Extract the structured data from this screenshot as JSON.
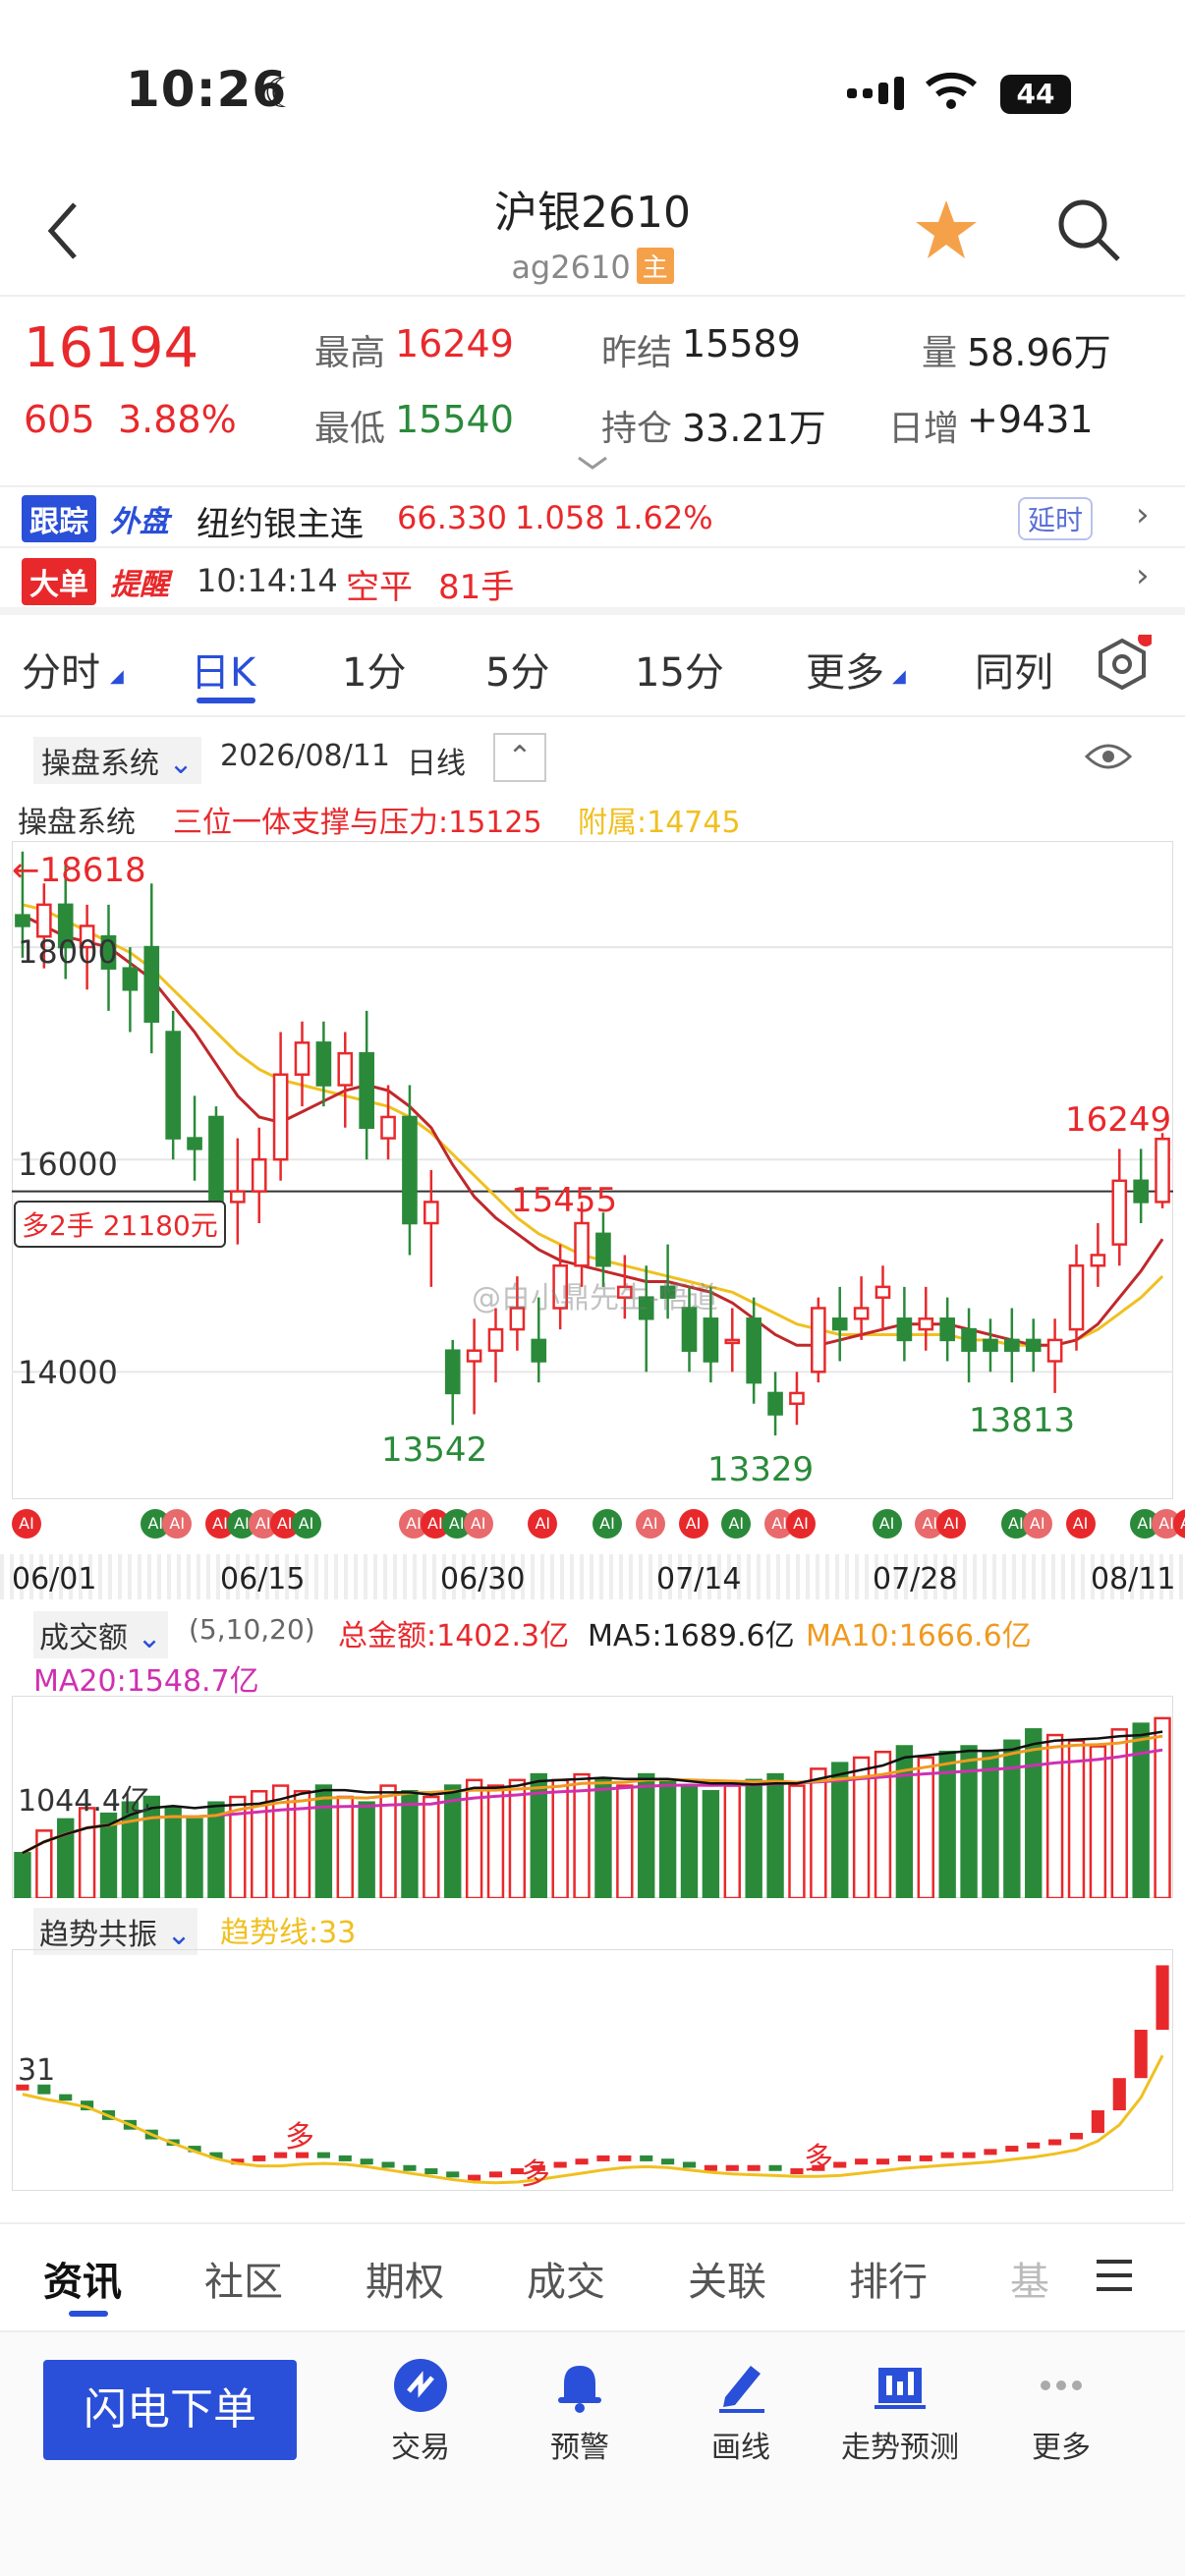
{
  "status_bar": {
    "time": "10:26",
    "battery": "44"
  },
  "header": {
    "title": "沪银2610",
    "code": "ag2610",
    "main_tag": "主"
  },
  "quote": {
    "last_price": "16194",
    "change": "605",
    "change_pct": "3.88%",
    "high_label": "最高",
    "high": "16249",
    "low_label": "最低",
    "low": "15540",
    "settle_label": "昨结",
    "settle": "15589",
    "oi_label": "持仓",
    "oi": "33.21万",
    "vol_label": "量",
    "vol": "58.96万",
    "daily_inc_label": "日增",
    "daily_inc": "+9431"
  },
  "track": {
    "badge1": "跟踪",
    "badge2": "外盘",
    "name": "纽约银主连",
    "price": "66.330",
    "chg": "1.058",
    "pct": "1.62%",
    "delay": "延时"
  },
  "alert": {
    "badge1": "大单",
    "badge2": "提醒",
    "time": "10:14:14",
    "type": "空平",
    "qty": "81手"
  },
  "period_tabs": [
    "分时",
    "日K",
    "1分",
    "5分",
    "15分",
    "更多",
    "同列"
  ],
  "chart_toolbar": {
    "system": "操盘系统",
    "date": "2026/08/11",
    "period": "日线"
  },
  "indicator": {
    "name": "操盘系统",
    "line1": "三位一体支撑与压力:15125",
    "line2": "附属:14745"
  },
  "price_labels": {
    "high_mark": "18618",
    "p18000": "18000",
    "p16000": "16000",
    "p14000": "14000",
    "cur_high": "16249",
    "l1": "13542",
    "l2": "15455",
    "l3": "13329",
    "l4": "13813",
    "position": "多2手 21180元",
    "watermark": "@白小鼎先生-悟道"
  },
  "dates": [
    "06/01",
    "06/15",
    "06/30",
    "07/14",
    "07/28",
    "08/11"
  ],
  "volume": {
    "name": "成交额",
    "params": "(5,10,20)",
    "total": "总金额:1402.3亿",
    "ma5": "MA5:1689.6亿",
    "ma10": "MA10:1666.6亿",
    "ma20": "MA20:1548.7亿",
    "axis": "1044.4亿"
  },
  "trend": {
    "name": "趋势共振",
    "line": "趋势线:33",
    "axis": "31",
    "mark": "多"
  },
  "subtabs": [
    "资讯",
    "社区",
    "期权",
    "成交",
    "关联",
    "排行",
    "基"
  ],
  "bottom_nav": {
    "order": "闪电下单",
    "items": [
      "交易",
      "预警",
      "画线",
      "走势预测",
      "更多"
    ]
  },
  "colors": {
    "up": "#e8292c",
    "down": "#2a8a3a",
    "ma_yellow": "#f0c020",
    "accent_blue": "#2a4fd8"
  },
  "chart_data": {
    "type": "candlestick",
    "ylim": [
      12800,
      19000
    ],
    "candles": [
      [
        18300,
        18200,
        18900,
        17900
      ],
      [
        18100,
        18400,
        18600,
        17800
      ],
      [
        18400,
        18000,
        18800,
        17700
      ],
      [
        18000,
        18200,
        18400,
        17600
      ],
      [
        18100,
        17800,
        18400,
        17400
      ],
      [
        17800,
        17600,
        18000,
        17200
      ],
      [
        18000,
        17300,
        18600,
        17000
      ],
      [
        17200,
        16200,
        17400,
        16000
      ],
      [
        16200,
        16100,
        16600,
        15800
      ],
      [
        16400,
        15500,
        16500,
        15300
      ],
      [
        15600,
        15700,
        16200,
        15200
      ],
      [
        15700,
        16000,
        16300,
        15400
      ],
      [
        16000,
        16800,
        17200,
        15800
      ],
      [
        16800,
        17100,
        17300,
        16500
      ],
      [
        17100,
        16700,
        17300,
        16500
      ],
      [
        16700,
        17000,
        17200,
        16300
      ],
      [
        17000,
        16300,
        17400,
        16000
      ],
      [
        16200,
        16400,
        16700,
        16000
      ],
      [
        16400,
        15400,
        16700,
        15100
      ],
      [
        15400,
        15600,
        15900,
        14800
      ],
      [
        14200,
        13800,
        14300,
        13500
      ],
      [
        14100,
        14200,
        14500,
        13600
      ],
      [
        14200,
        14400,
        14600,
        13900
      ],
      [
        14400,
        14600,
        14900,
        14200
      ],
      [
        14300,
        14100,
        14700,
        13900
      ],
      [
        14600,
        15000,
        15200,
        14400
      ],
      [
        15000,
        15400,
        15600,
        14800
      ],
      [
        15300,
        15000,
        15500,
        14800
      ],
      [
        14700,
        14800,
        15100,
        14500
      ],
      [
        14700,
        14500,
        15000,
        14000
      ],
      [
        14800,
        14700,
        15200,
        14500
      ],
      [
        14600,
        14200,
        14800,
        14000
      ],
      [
        14500,
        14100,
        14800,
        13900
      ],
      [
        14300,
        14300,
        14600,
        14000
      ],
      [
        14500,
        13900,
        14700,
        13700
      ],
      [
        13800,
        13600,
        14000,
        13400
      ],
      [
        13700,
        13800,
        14000,
        13500
      ],
      [
        14000,
        14600,
        14700,
        13900
      ],
      [
        14500,
        14400,
        14800,
        14100
      ],
      [
        14500,
        14600,
        14900,
        14300
      ],
      [
        14700,
        14800,
        15000,
        14400
      ],
      [
        14500,
        14300,
        14800,
        14100
      ],
      [
        14400,
        14500,
        14800,
        14200
      ],
      [
        14500,
        14300,
        14700,
        14100
      ],
      [
        14400,
        14200,
        14600,
        13900
      ],
      [
        14300,
        14200,
        14500,
        14000
      ],
      [
        14300,
        14200,
        14600,
        13900
      ],
      [
        14300,
        14200,
        14500,
        14000
      ],
      [
        14100,
        14300,
        14500,
        13800
      ],
      [
        14400,
        15000,
        15200,
        14200
      ],
      [
        15000,
        15100,
        15400,
        14800
      ],
      [
        15200,
        15800,
        16100,
        15000
      ],
      [
        15800,
        15600,
        16100,
        15400
      ],
      [
        15600,
        16194,
        16249,
        15540
      ]
    ],
    "ma_red": [
      18300,
      18200,
      18100,
      18050,
      18000,
      17850,
      17700,
      17450,
      17200,
      16900,
      16600,
      16400,
      16350,
      16450,
      16550,
      16650,
      16700,
      16650,
      16500,
      16300,
      15950,
      15650,
      15450,
      15300,
      15150,
      15050,
      15000,
      14950,
      14900,
      14850,
      14850,
      14800,
      14750,
      14650,
      14500,
      14350,
      14250,
      14250,
      14300,
      14350,
      14400,
      14450,
      14450,
      14450,
      14400,
      14350,
      14300,
      14250,
      14250,
      14300,
      14450,
      14700,
      14950,
      15250
    ],
    "ma_yellow": [
      18400,
      18350,
      18250,
      18150,
      18050,
      17950,
      17800,
      17600,
      17400,
      17200,
      17000,
      16850,
      16750,
      16700,
      16650,
      16600,
      16550,
      16500,
      16400,
      16250,
      16050,
      15850,
      15650,
      15450,
      15300,
      15200,
      15100,
      15050,
      15000,
      14950,
      14900,
      14850,
      14800,
      14750,
      14650,
      14550,
      14450,
      14400,
      14350,
      14350,
      14350,
      14350,
      14350,
      14350,
      14300,
      14300,
      14250,
      14250,
      14250,
      14300,
      14400,
      14550,
      14700,
      14900
    ],
    "volume_ylim": [
      0,
      1800
    ],
    "volume_values": [
      400,
      600,
      700,
      800,
      750,
      850,
      900,
      800,
      700,
      850,
      900,
      950,
      1000,
      950,
      1000,
      900,
      850,
      1000,
      950,
      900,
      1000,
      1050,
      1000,
      1050,
      1100,
      1050,
      1100,
      1050,
      1000,
      1100,
      1050,
      1000,
      950,
      1000,
      1050,
      1100,
      1000,
      1150,
      1200,
      1250,
      1300,
      1350,
      1250,
      1300,
      1350,
      1300,
      1400,
      1500,
      1450,
      1400,
      1350,
      1500,
      1550,
      1600
    ],
    "trend_values": [
      31.3,
      31.0,
      30.8,
      30.5,
      30.2,
      29.9,
      29.6,
      29.4,
      29.2,
      29.0,
      29.0,
      29.1,
      29.2,
      29.2,
      29.1,
      29.0,
      28.9,
      28.8,
      28.7,
      28.6,
      28.5,
      28.5,
      28.6,
      28.7,
      28.8,
      28.9,
      29.0,
      29.1,
      29.1,
      29.0,
      28.9,
      28.8,
      28.8,
      28.8,
      28.8,
      28.7,
      28.7,
      28.8,
      28.9,
      29.0,
      29.0,
      29.1,
      29.1,
      29.2,
      29.2,
      29.3,
      29.4,
      29.5,
      29.6,
      29.8,
      30.5,
      31.5,
      33.0,
      35.0
    ],
    "trend_ylim": [
      28,
      35.5
    ]
  }
}
